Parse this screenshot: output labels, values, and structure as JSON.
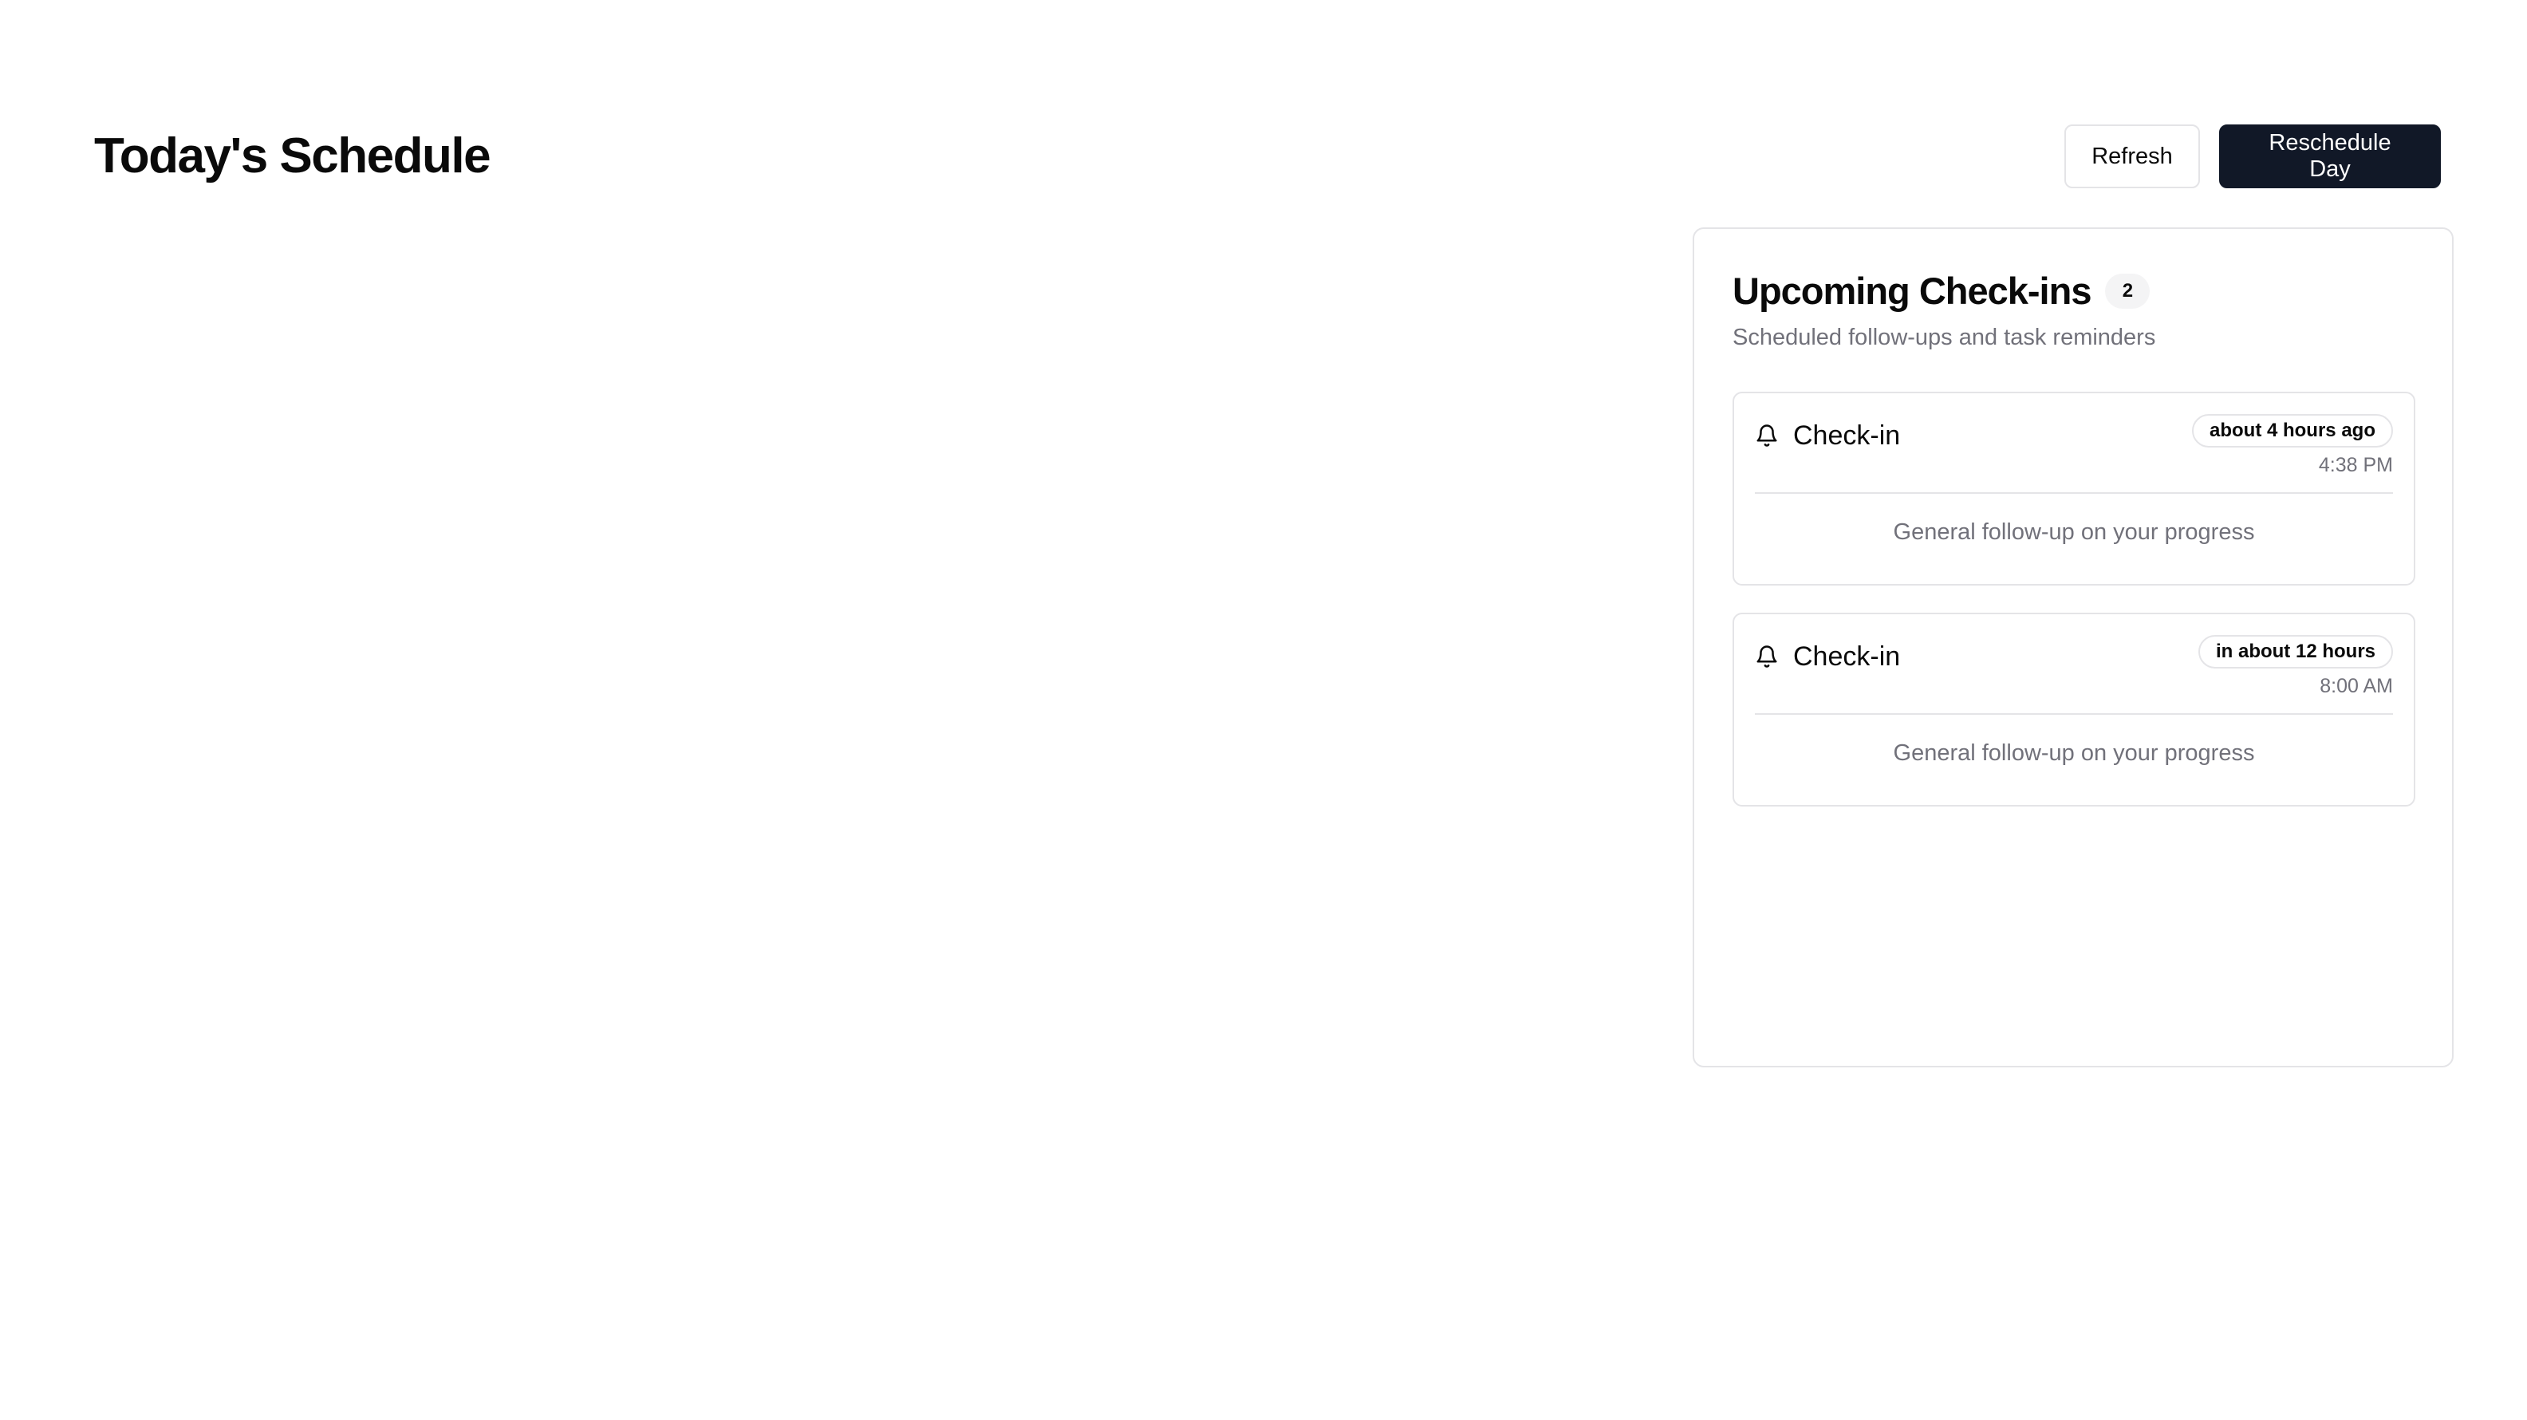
{
  "header": {
    "title": "Today's Schedule",
    "refresh_label": "Refresh",
    "reschedule_label": "Reschedule Day"
  },
  "checkins": {
    "title": "Upcoming Check-ins",
    "count": "2",
    "subtitle": "Scheduled follow-ups and task reminders",
    "items": [
      {
        "icon": "bell-icon",
        "title": "Check-in",
        "relative_time": "about 4 hours ago",
        "time": "4:38 PM",
        "description": "General follow-up on your progress"
      },
      {
        "icon": "bell-icon",
        "title": "Check-in",
        "relative_time": "in about 12 hours",
        "time": "8:00 AM",
        "description": "General follow-up on your progress"
      }
    ]
  },
  "colors": {
    "primary": "#111827",
    "muted_text": "#71717a",
    "border": "#e4e4e7"
  }
}
